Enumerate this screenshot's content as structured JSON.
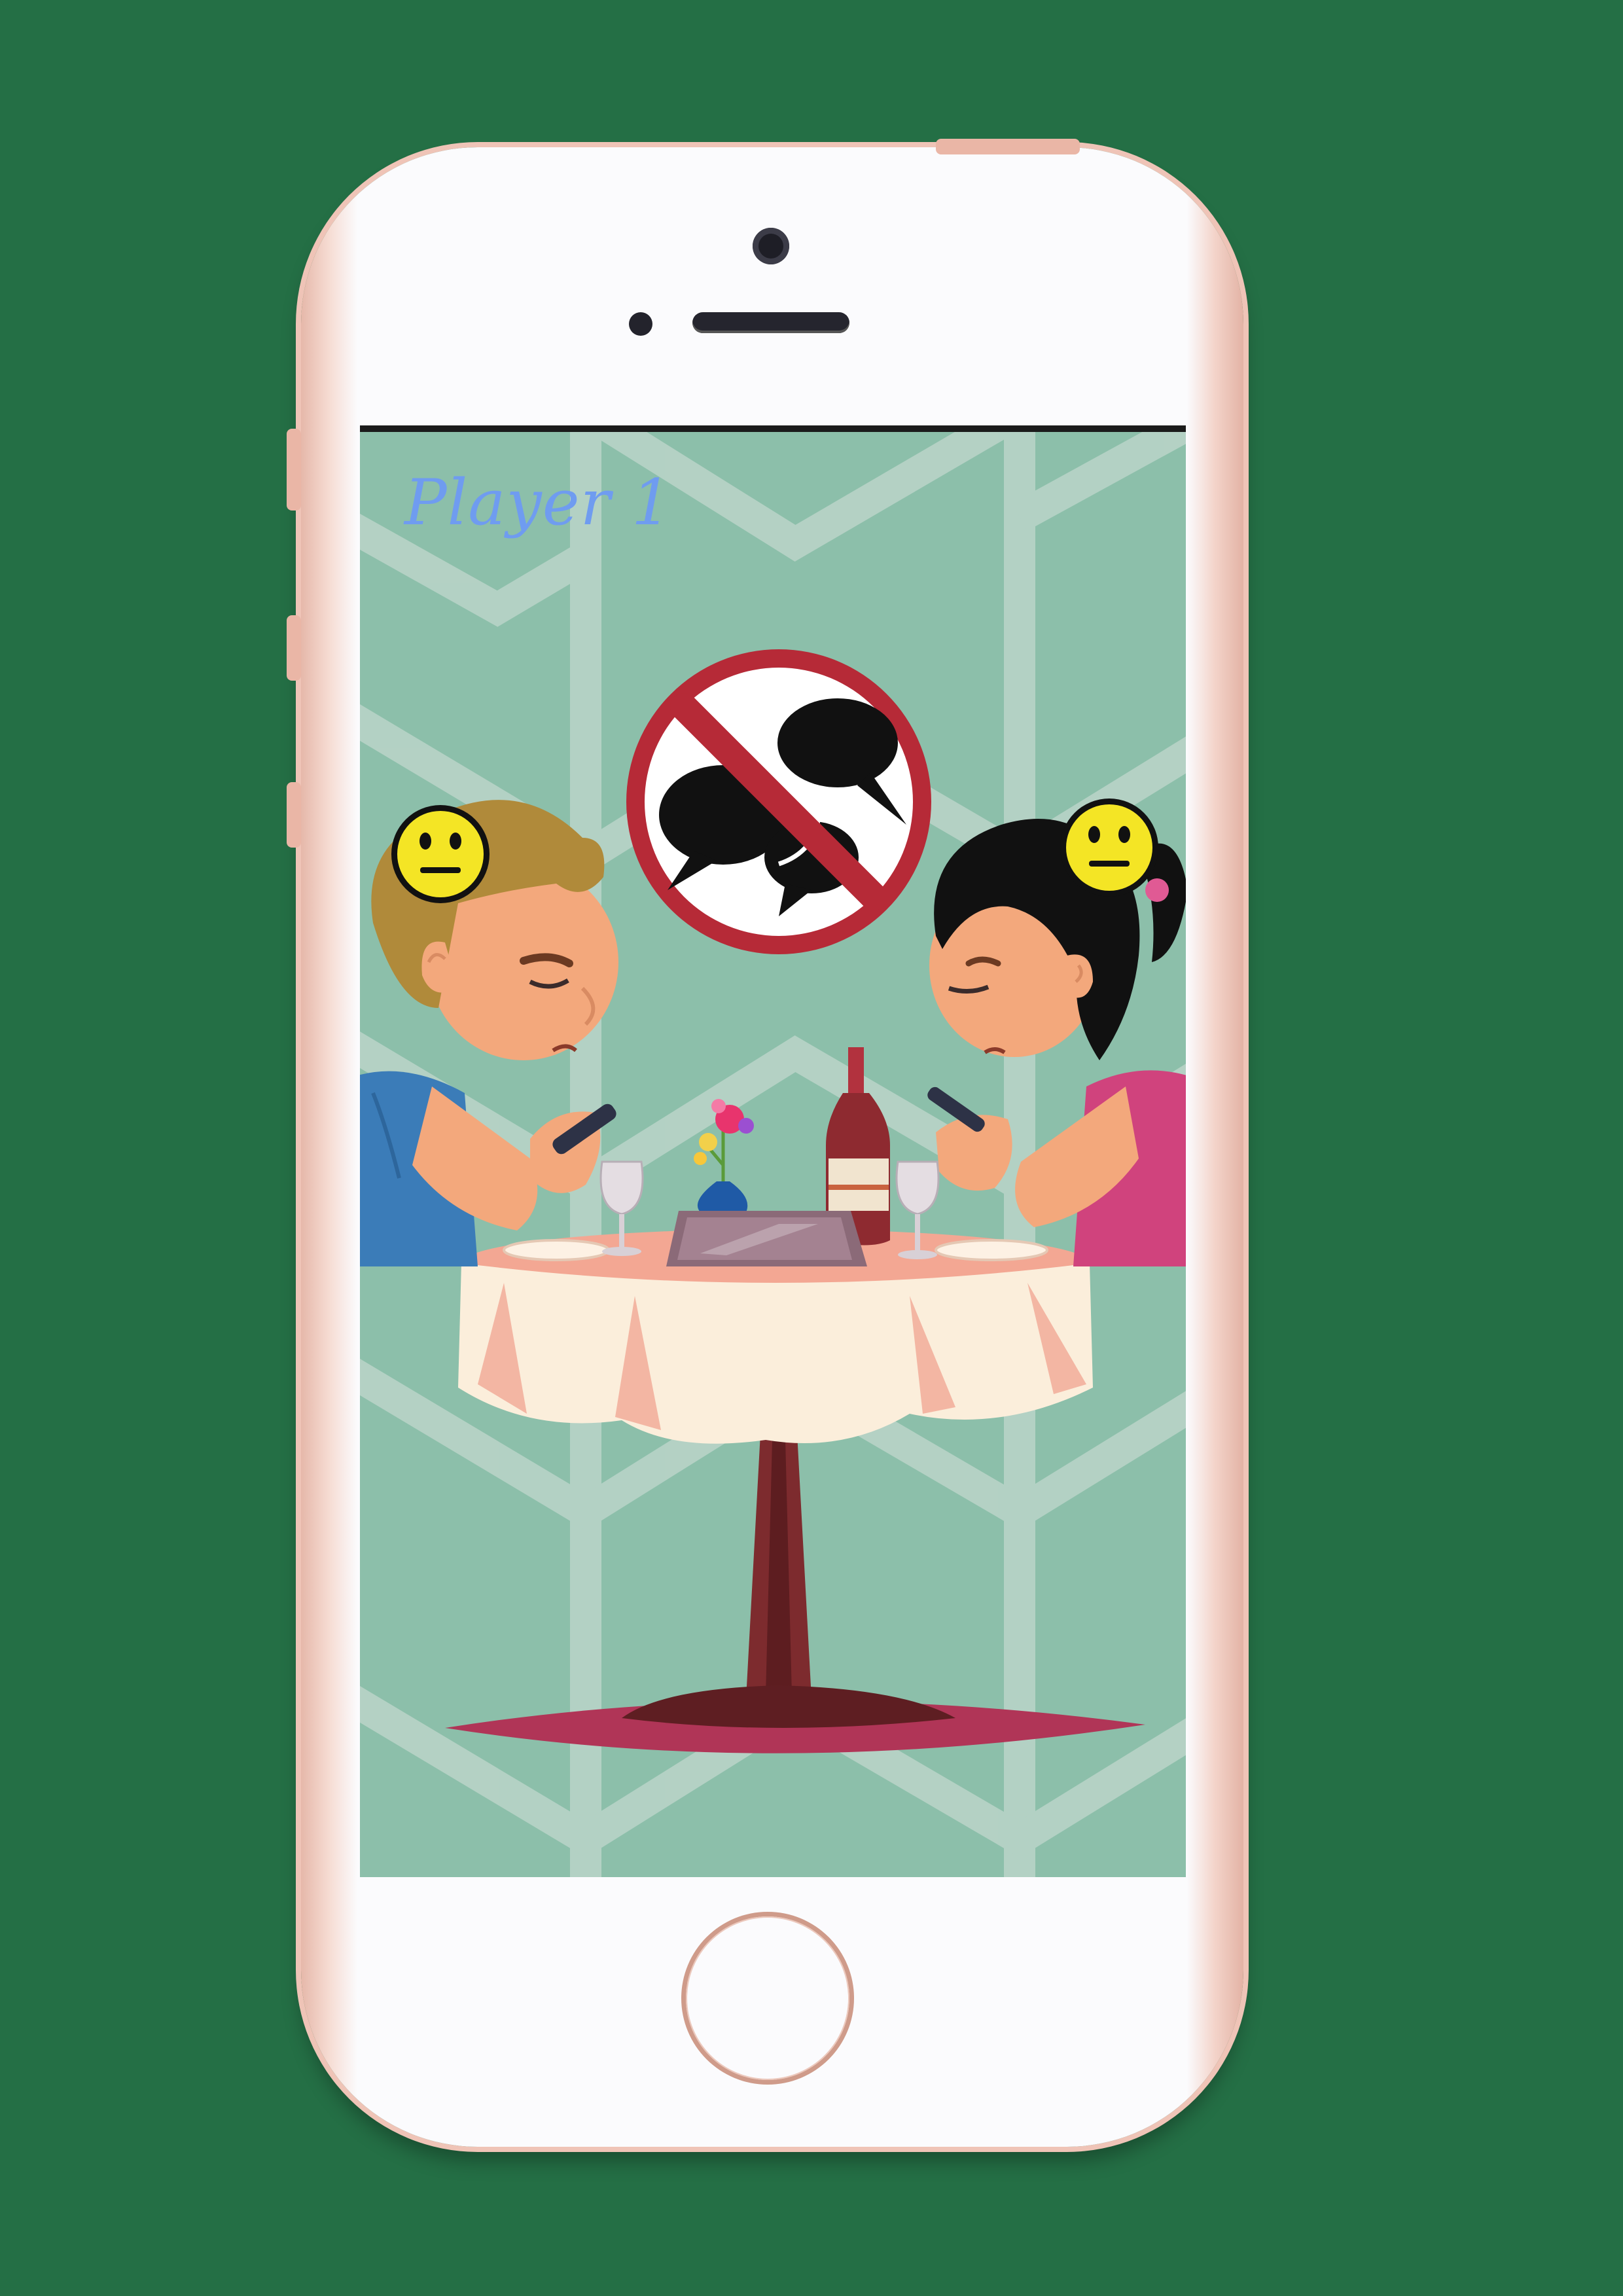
{
  "game": {
    "player_label": "Player 1"
  },
  "icons": {
    "no_chat": "no-talking-sign-icon",
    "left_mood": "neutral-face-icon",
    "right_mood": "neutral-face-icon"
  },
  "colors": {
    "background": "#246f45",
    "screen_bg": "#8cbfaa",
    "pattern": "#b8d3c7",
    "sign_red": "#b62a37",
    "label_blue": "#6f9cf0"
  }
}
